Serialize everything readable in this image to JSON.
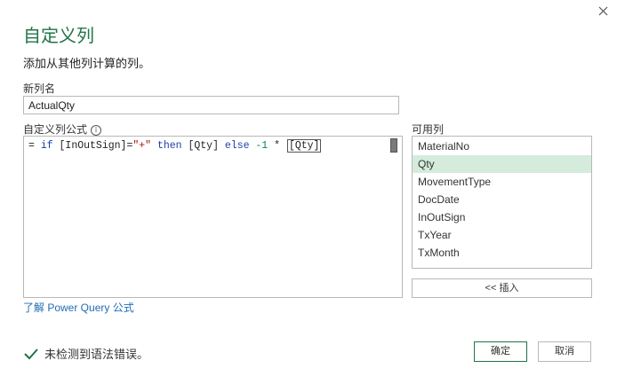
{
  "dialog": {
    "title": "自定义列",
    "subtitle": "添加从其他列计算的列。"
  },
  "new_column": {
    "label": "新列名",
    "value": "ActualQty"
  },
  "formula": {
    "label": "自定义列公式",
    "info_icon": "ⓘ",
    "tokens": {
      "prefix": "= ",
      "if": "if",
      "col1": " [InOutSign]=",
      "str": "\"+\"",
      "then": " then",
      "col2": " [Qty] ",
      "else": "else",
      "minus1": " -1",
      "op": " * ",
      "col3": "[Qty]"
    }
  },
  "available_columns": {
    "label": "可用列",
    "items": [
      "MaterialNo",
      "Qty",
      "MovementType",
      "DocDate",
      "InOutSign",
      "TxYear",
      "TxMonth"
    ],
    "selected_index": 1,
    "insert_label": "<< 插入"
  },
  "learn_link": "了解 Power Query 公式",
  "status": {
    "text": "未检测到语法错误。",
    "icon": "check-icon"
  },
  "buttons": {
    "ok": "确定",
    "cancel": "取消"
  },
  "colors": {
    "accent": "#217346",
    "selection": "#d5ecdc",
    "link": "#1f6db5"
  }
}
